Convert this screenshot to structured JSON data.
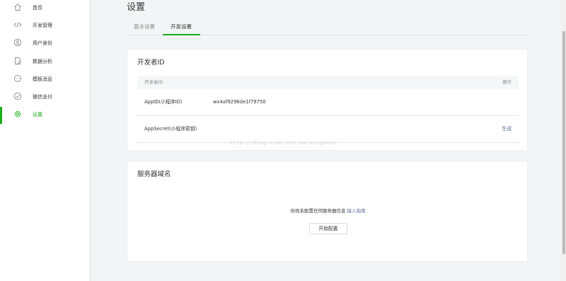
{
  "sidebar": {
    "items": [
      {
        "label": "首页",
        "icon": "home-icon"
      },
      {
        "label": "开发管理",
        "icon": "code-icon"
      },
      {
        "label": "用户身份",
        "icon": "user-icon"
      },
      {
        "label": "数据分析",
        "icon": "analytics-icon"
      },
      {
        "label": "模板消息",
        "icon": "message-icon"
      },
      {
        "label": "微信支付",
        "icon": "payment-icon"
      },
      {
        "label": "设置",
        "icon": "gear-icon",
        "active": true
      }
    ]
  },
  "header": {
    "title": "设置",
    "tabs": [
      {
        "label": "基本设置"
      },
      {
        "label": "开发设置",
        "active": true
      }
    ]
  },
  "developer_id": {
    "title": "开发者ID",
    "columns": [
      "开发者ID",
      "操作"
    ],
    "rows": [
      {
        "key": "AppID(小程序ID)",
        "value": "wx4af9296de1f79750",
        "action": ""
      },
      {
        "key": "AppSecret(小程序密钥)",
        "value": "",
        "action": "生成"
      }
    ]
  },
  "server_domain": {
    "title": "服务器域名",
    "empty_text": "你尚未配置任何服务器信息",
    "guide_link": "接入指南",
    "config_button": "开始配置"
  },
  "watermark": "http://blog.csdn.net/walkingmanc",
  "colors": {
    "accent": "#1aad19",
    "link": "#576b95",
    "background": "#f3f4f6"
  }
}
